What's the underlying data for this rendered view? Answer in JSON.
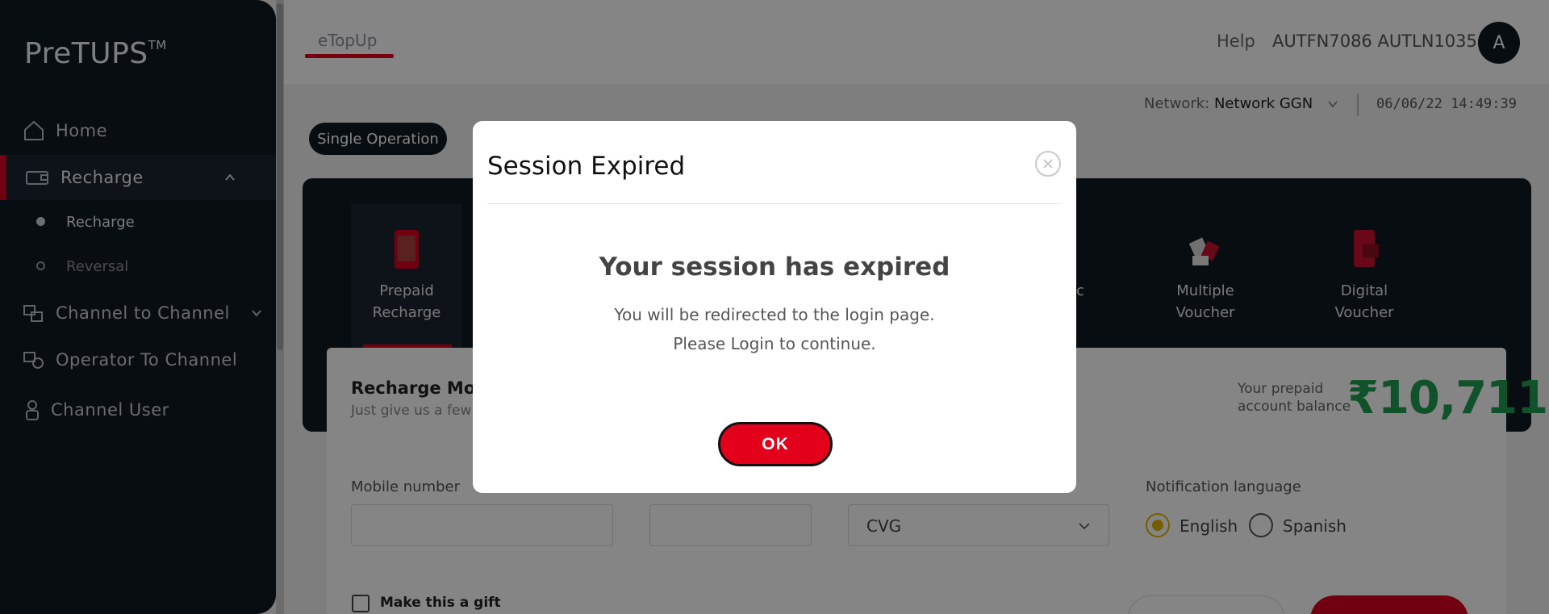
{
  "app": {
    "logo": "PreTUPS",
    "logo_tm": "TM"
  },
  "sidebar": {
    "items": [
      {
        "label": "Home",
        "icon": "home-icon"
      },
      {
        "label": "Recharge",
        "icon": "recharge-icon",
        "active": true,
        "expanded": true
      },
      {
        "label": "Channel to Channel",
        "icon": "channel-transfer-icon"
      },
      {
        "label": "Operator To Channel",
        "icon": "operator-transfer-icon"
      },
      {
        "label": "Channel User",
        "icon": "user-icon"
      }
    ],
    "sub_items": [
      {
        "label": "Recharge",
        "selected": true
      },
      {
        "label": "Reversal",
        "selected": false
      }
    ]
  },
  "header": {
    "tab": "eTopUp",
    "help": "Help",
    "user": "AUTFN7086 AUTLN1035",
    "avatar_letter": "A"
  },
  "network": {
    "label": "Network:",
    "value": "Network GGN",
    "datetime": "06/06/22 14:49:39"
  },
  "operation_tab": "Single Operation",
  "services": [
    {
      "line1": "Prepaid",
      "line2": "Recharge",
      "active": true
    },
    {
      "line1": "c",
      "line2": ""
    },
    {
      "line1": "Multiple",
      "line2": "Voucher"
    },
    {
      "line1": "Digital",
      "line2": "Voucher"
    }
  ],
  "form": {
    "title": "Recharge Mob",
    "subtitle": "Just give us a few",
    "balance_label_1": "Your prepaid",
    "balance_label_2": "account balance",
    "balance": "₹10,711",
    "mobile_label": "Mobile number",
    "selector_value": "CVG",
    "notification_label": "Notification language",
    "languages": [
      "English",
      "Spanish"
    ],
    "selected_language": "English",
    "gift_label": "Make this a gift"
  },
  "modal": {
    "title": "Session Expired",
    "heading": "Your session has expired",
    "message_1": "You will be redirected to the login page.",
    "message_2": "Please Login to continue.",
    "ok_label": "OK"
  },
  "colors": {
    "sidebar_bg": "#111a24",
    "accent_red": "#e3001b",
    "balance_green": "#1f9d4f",
    "radio_selected": "#e0b400"
  }
}
